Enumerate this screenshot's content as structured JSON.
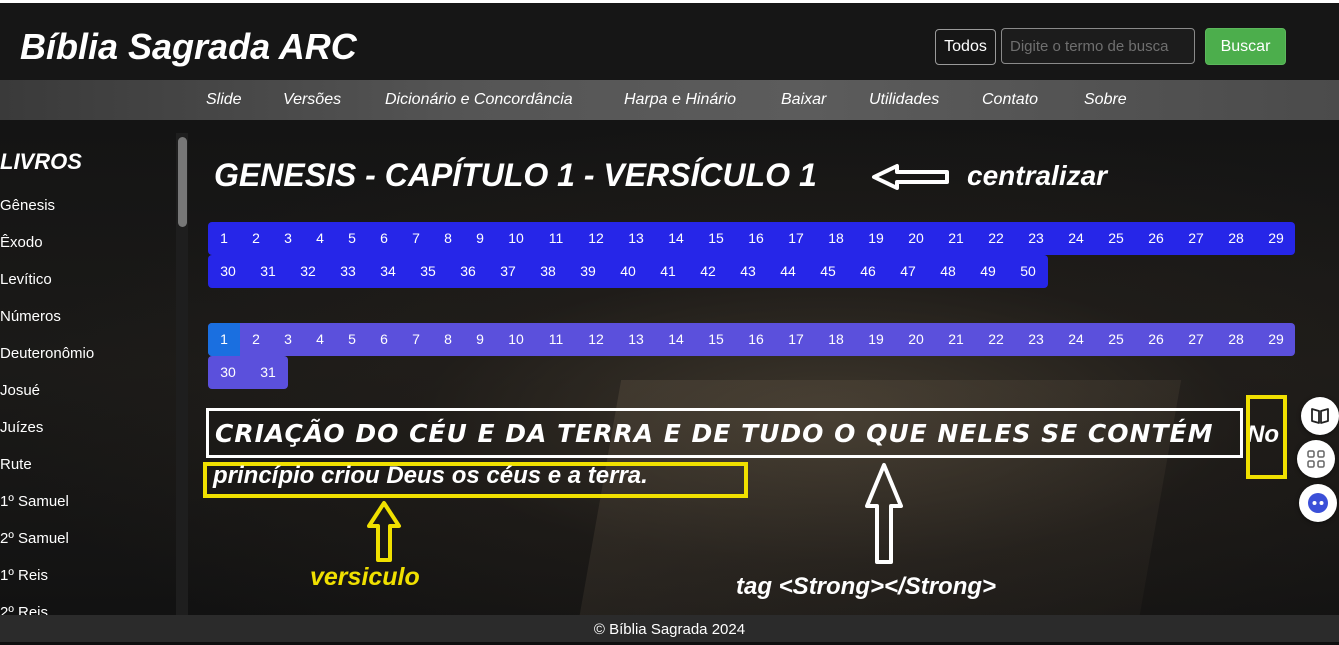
{
  "header": {
    "title": "Bíblia Sagrada ARC",
    "filter_label": "Todos",
    "search_placeholder": "Digite o termo de busca",
    "search_button": "Buscar"
  },
  "nav": {
    "items": [
      "Slide",
      "Versões",
      "Dicionário e Concordância",
      "Harpa e Hinário",
      "Baixar",
      "Utilidades",
      "Contato",
      "Sobre"
    ]
  },
  "sidebar": {
    "title": "LIVROS",
    "books": [
      "Gênesis",
      "Êxodo",
      "Levítico",
      "Números",
      "Deuteronômio",
      "Josué",
      "Juízes",
      "Rute",
      "1º Samuel",
      "2º Samuel",
      "1º Reis",
      "2º Reis"
    ]
  },
  "content": {
    "heading": "GENESIS - CAPÍTULO 1 - VERSÍCULO 1",
    "annotation_centralizar": "centralizar",
    "chapters": [
      "1",
      "2",
      "3",
      "4",
      "5",
      "6",
      "7",
      "8",
      "9",
      "10",
      "11",
      "12",
      "13",
      "14",
      "15",
      "16",
      "17",
      "18",
      "19",
      "20",
      "21",
      "22",
      "23",
      "24",
      "25",
      "26",
      "27",
      "28",
      "29",
      "30",
      "31",
      "32",
      "33",
      "34",
      "35",
      "36",
      "37",
      "38",
      "39",
      "40",
      "41",
      "42",
      "43",
      "44",
      "45",
      "46",
      "47",
      "48",
      "49",
      "50"
    ],
    "verses": [
      "1",
      "2",
      "3",
      "4",
      "5",
      "6",
      "7",
      "8",
      "9",
      "10",
      "11",
      "12",
      "13",
      "14",
      "15",
      "16",
      "17",
      "18",
      "19",
      "20",
      "21",
      "22",
      "23",
      "24",
      "25",
      "26",
      "27",
      "28",
      "29",
      "30",
      "31"
    ],
    "active_verse": "1",
    "subtitle": "CRIAÇÃO DO CÉU E DA TERRA E DE TUDO O QUE NELES SE CONTÉM",
    "verse_word_start": "No",
    "verse_text": "princípio criou Deus os céus e a terra.",
    "annotation_versiculo": "versiculo",
    "annotation_tag": "tag <Strong></Strong>"
  },
  "footer": {
    "text": "© Bíblia Sagrada 2024"
  },
  "colors": {
    "chapter_button": "#2626e8",
    "verse_button": "#5b50dc",
    "active_verse": "#1a6fe0",
    "search_button": "#4cae4c",
    "annotation_yellow": "#f0e000"
  },
  "icons": [
    "book-open-icon",
    "apps-grid-icon",
    "assistant-bot-icon",
    "arrow-left-icon",
    "arrow-up-icon"
  ]
}
